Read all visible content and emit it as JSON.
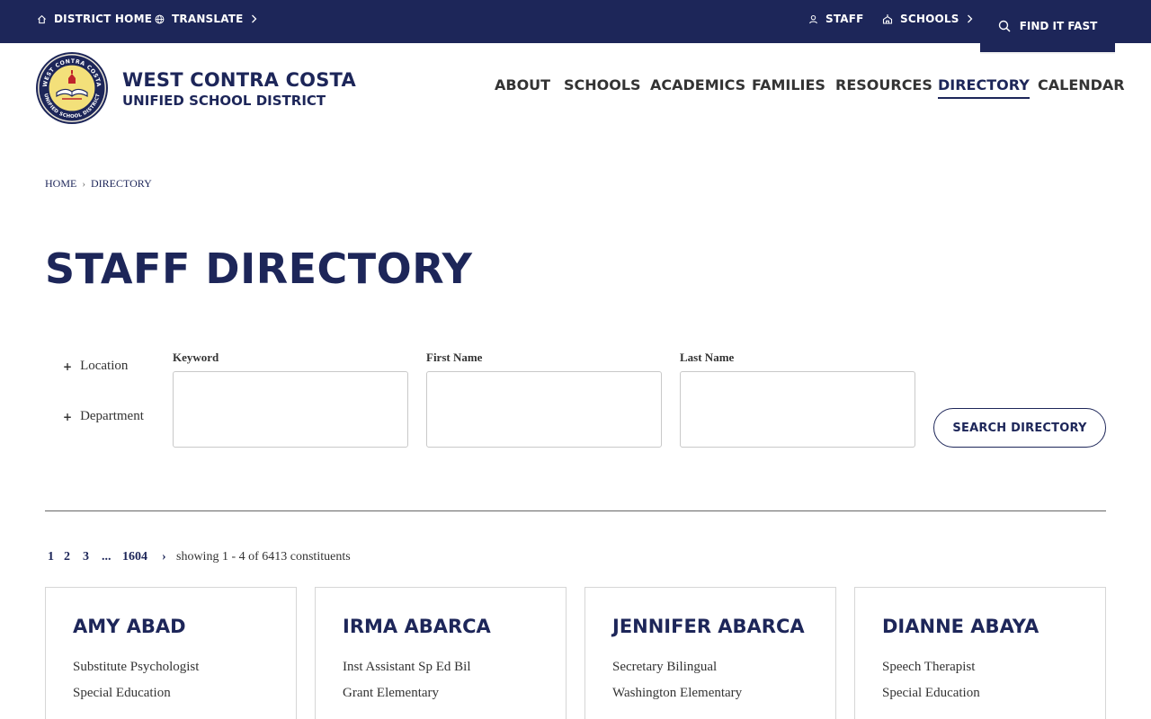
{
  "utility_bar": {
    "district_home": "DISTRICT HOME",
    "translate": "TRANSLATE",
    "staff": "STAFF",
    "schools": "SCHOOLS",
    "find_it_fast": "FIND IT FAST"
  },
  "header": {
    "name_line1": "WEST CONTRA COSTA",
    "name_line2": "UNIFIED SCHOOL DISTRICT",
    "seal_top_text": "WEST CONTRA COSTA",
    "seal_bottom_text": "UNIFIED SCHOOL DISTRICT"
  },
  "nav": {
    "items": [
      "ABOUT",
      "SCHOOLS",
      "ACADEMICS",
      "FAMILIES",
      "RESOURCES",
      "DIRECTORY",
      "CALENDAR"
    ],
    "active": "DIRECTORY"
  },
  "breadcrumb": {
    "home": "HOME",
    "current": "DIRECTORY"
  },
  "page": {
    "title": "STAFF DIRECTORY"
  },
  "filters": {
    "location": "Location",
    "department": "Department",
    "keyword_label": "Keyword",
    "keyword_value": "",
    "first_name_label": "First Name",
    "first_name_value": "",
    "last_name_label": "Last Name",
    "last_name_value": "",
    "search_button": "SEARCH DIRECTORY"
  },
  "pagination": {
    "pages": [
      "1",
      "2",
      "3",
      "...",
      "1604"
    ],
    "next": "›",
    "summary": "showing 1 - 4 of 6413 constituents"
  },
  "results": [
    {
      "name": "AMY ABAD",
      "title": "Substitute Psychologist",
      "location": "Special Education"
    },
    {
      "name": "IRMA ABARCA",
      "title": "Inst Assistant Sp Ed Bil",
      "location": "Grant Elementary"
    },
    {
      "name": "JENNIFER ABARCA",
      "title": "Secretary Bilingual",
      "location": "Washington Elementary"
    },
    {
      "name": "DIANNE ABAYA",
      "title": "Speech Therapist",
      "location": "Special Education"
    }
  ],
  "colors": {
    "navy": "#1d2659",
    "text": "#333333",
    "border": "#d6d6d6"
  }
}
